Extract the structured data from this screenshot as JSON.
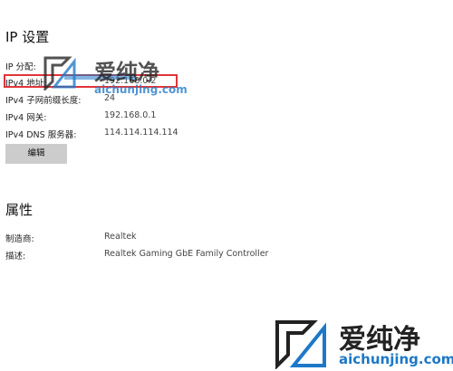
{
  "ip_section": {
    "title": "IP 设置",
    "rows": [
      {
        "key": "IP 分配:",
        "value": ""
      },
      {
        "key": "IPv4 地址:",
        "value": "192.168.0.2"
      },
      {
        "key": "IPv4 子网前缀长度:",
        "value": "24"
      },
      {
        "key": "IPv4 网关:",
        "value": "192.168.0.1"
      },
      {
        "key": "IPv4 DNS 服务器:",
        "value": "114.114.114.114"
      }
    ],
    "edit_label": "编辑"
  },
  "props_section": {
    "title": "属性",
    "rows": [
      {
        "key": "制造商:",
        "value": "Realtek"
      },
      {
        "key": "描述:",
        "value": "Realtek Gaming GbE Family Controller"
      }
    ]
  },
  "watermark": {
    "cn": "爱纯净",
    "url": "aichunjing.com",
    "colors": {
      "primary": "#1e78c8",
      "text": "#222222"
    },
    "icon": "aichunjing-logo-icon"
  },
  "highlight_color": "#e0353a"
}
